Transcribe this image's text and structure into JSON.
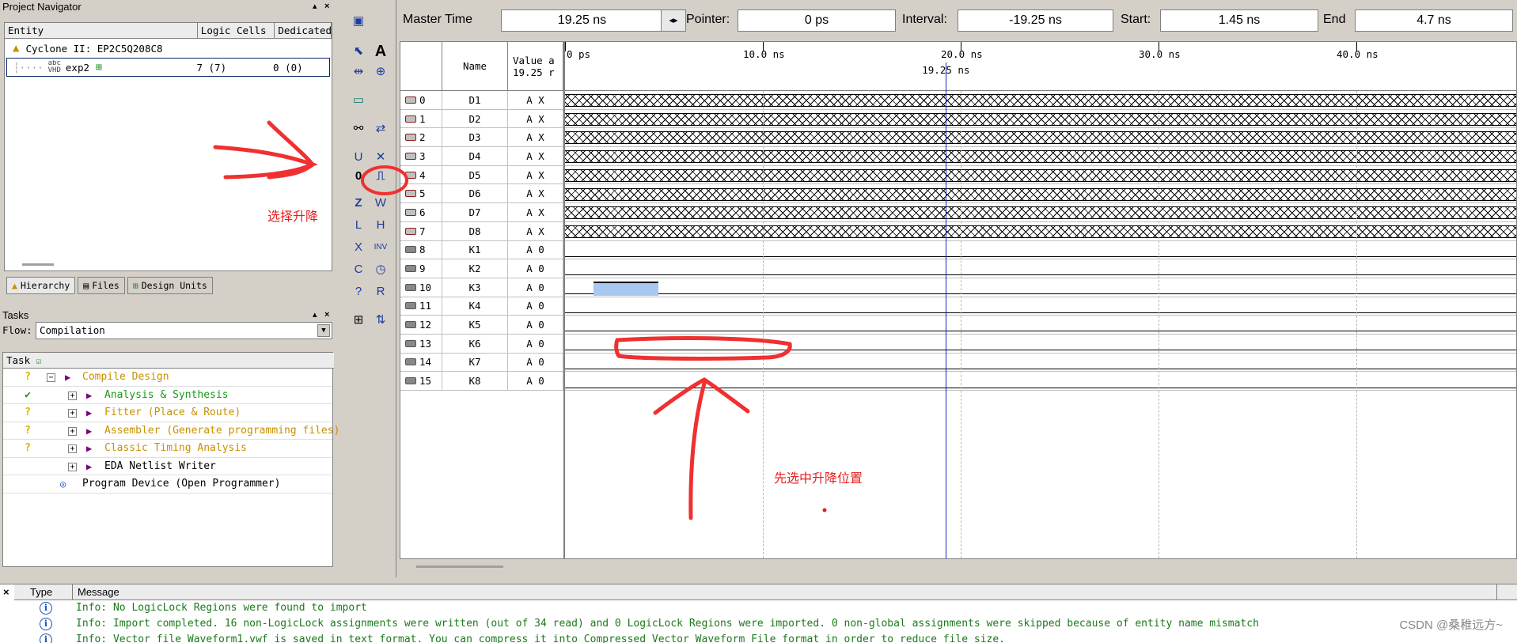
{
  "navigator": {
    "title": "Project Navigator",
    "columns": [
      "Entity",
      "Logic Cells",
      "Dedicated"
    ],
    "rows": [
      {
        "entity": "Cyclone II: EP2C5Q208C8",
        "cells": "",
        "dedicated": ""
      },
      {
        "entity": "exp2",
        "cells": "7 (7)",
        "dedicated": "0 (0)"
      }
    ],
    "tabs": [
      "Hierarchy",
      "Files",
      "Design Units"
    ]
  },
  "tasks": {
    "title": "Tasks",
    "flow_label": "Flow:",
    "flow_value": "Compilation",
    "header": "Task",
    "items": [
      {
        "label": "Compile Design",
        "status": "?",
        "color": "#c89000"
      },
      {
        "label": "Analysis & Synthesis",
        "status": "✔",
        "color": "#1a9a1a"
      },
      {
        "label": "Fitter (Place & Route)",
        "status": "?",
        "color": "#c89000"
      },
      {
        "label": "Assembler (Generate programming files)",
        "status": "?",
        "color": "#c89000"
      },
      {
        "label": "Classic Timing Analysis",
        "status": "?",
        "color": "#c89000"
      },
      {
        "label": "EDA Netlist Writer",
        "status": "",
        "color": "#000000"
      },
      {
        "label": "Program Device (Open Programmer)",
        "status": "",
        "color": "#000000"
      }
    ]
  },
  "timebar": {
    "master_label": "Master Time",
    "master_value": "19.25 ns",
    "pointer_label": "Pointer:",
    "pointer_value": "0 ps",
    "interval_label": "Interval:",
    "interval_value": "-19.25 ns",
    "start_label": "Start:",
    "start_value": "1.45 ns",
    "end_label": "End",
    "end_value": "4.7 ns"
  },
  "waveform": {
    "name_header": "Name",
    "value_header": "Value a",
    "value_header2": "19.25 r",
    "ticks": [
      "0 ps",
      "10.0 ns",
      "20.0 ns",
      "30.0 ns",
      "40.0 ns"
    ],
    "cursor_label": "19.25 ns",
    "signals": [
      {
        "idx": "0",
        "name": "D1",
        "value": "A X",
        "kind": "x"
      },
      {
        "idx": "1",
        "name": "D2",
        "value": "A X",
        "kind": "x"
      },
      {
        "idx": "2",
        "name": "D3",
        "value": "A X",
        "kind": "x"
      },
      {
        "idx": "3",
        "name": "D4",
        "value": "A X",
        "kind": "x"
      },
      {
        "idx": "4",
        "name": "D5",
        "value": "A X",
        "kind": "x"
      },
      {
        "idx": "5",
        "name": "D6",
        "value": "A X",
        "kind": "x"
      },
      {
        "idx": "6",
        "name": "D7",
        "value": "A X",
        "kind": "x"
      },
      {
        "idx": "7",
        "name": "D8",
        "value": "A X",
        "kind": "x"
      },
      {
        "idx": "8",
        "name": "K1",
        "value": "A 0",
        "kind": "0"
      },
      {
        "idx": "9",
        "name": "K2",
        "value": "A 0",
        "kind": "0"
      },
      {
        "idx": "10",
        "name": "K3",
        "value": "A 0",
        "kind": "0"
      },
      {
        "idx": "11",
        "name": "K4",
        "value": "A 0",
        "kind": "0"
      },
      {
        "idx": "12",
        "name": "K5",
        "value": "A 0",
        "kind": "0"
      },
      {
        "idx": "13",
        "name": "K6",
        "value": "A 0",
        "kind": "0"
      },
      {
        "idx": "14",
        "name": "K7",
        "value": "A 0",
        "kind": "0"
      },
      {
        "idx": "15",
        "name": "K8",
        "value": "A 0",
        "kind": "0"
      }
    ]
  },
  "annotations": {
    "select_rising": "选择升降",
    "select_first": "先选中升降位置"
  },
  "messages": {
    "columns": [
      "Type",
      "Message"
    ],
    "rows": [
      "Info: No LogicLock Regions were found to import",
      "Info: Import completed.  16 non-LogicLock assignments were written (out of 34 read) and 0 LogicLock Regions were imported.  0 non-global assignments were skipped because of entity name mismatch",
      "Info: Vector file Waveform1.vwf is saved in text format. You can compress it into Compressed Vector Waveform File format in order to reduce file size."
    ],
    "watermark": "CSDN @桑稚远方~"
  }
}
